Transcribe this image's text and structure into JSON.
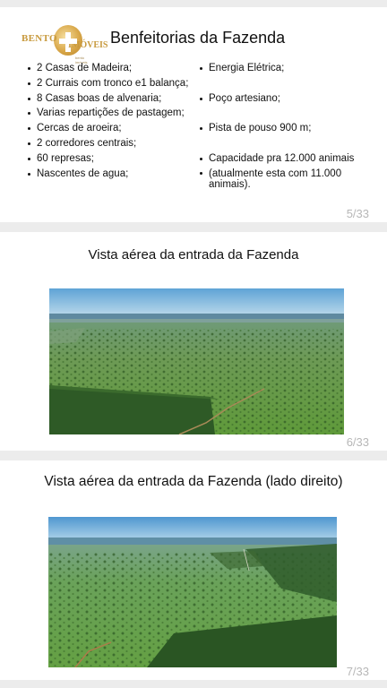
{
  "slide5": {
    "logo": {
      "word1": "BENTO",
      "word2": "IMÓVEIS",
      "tagline": "bento imóveis"
    },
    "title": "Benfeitorias da Fazenda",
    "left_items": [
      "2 Casas de Madeira;",
      "2 Currais com tronco e1 balança;",
      "8 Casas boas de alvenaria;",
      "Varias repartições de pastagem;",
      "Cercas de aroeira;",
      "2 corredores centrais;",
      "60 represas;",
      "Nascentes de agua;"
    ],
    "right_items": [
      "Energia Elétrica;",
      "Poço artesiano;",
      "Pista de pouso 900 m;",
      "Capacidade pra 12.000 animais",
      "(atualmente esta com 11.000 animais)."
    ],
    "page": "5/33"
  },
  "slide6": {
    "title": "Vista aérea da entrada da Fazenda",
    "page": "6/33"
  },
  "slide7": {
    "title": "Vista aérea da entrada da Fazenda (lado direito)",
    "page": "7/33"
  }
}
